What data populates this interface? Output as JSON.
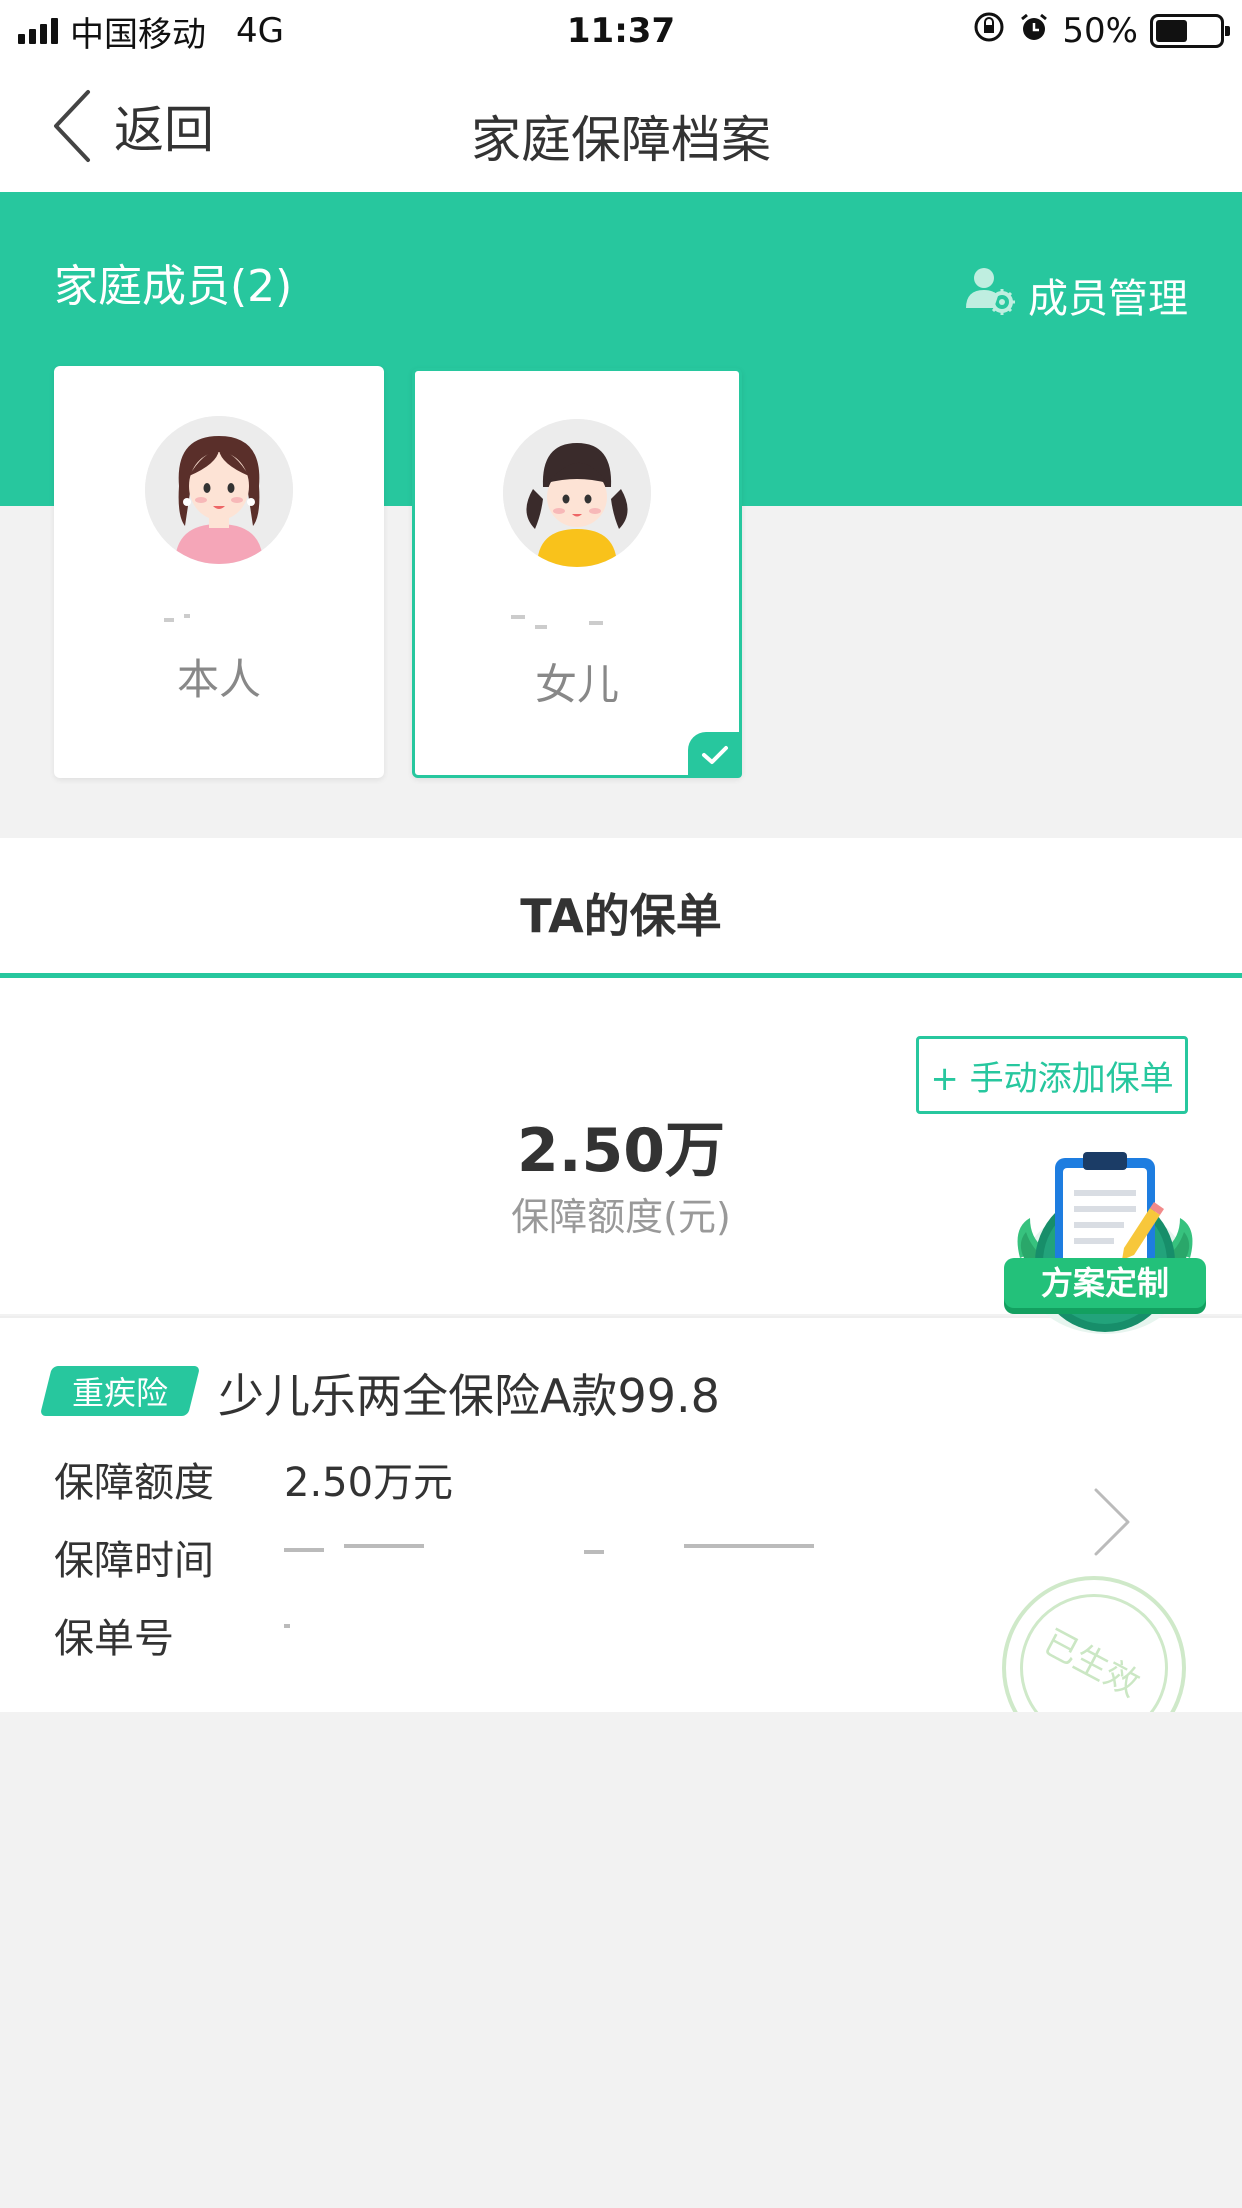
{
  "status_bar": {
    "carrier": "中国移动",
    "network": "4G",
    "time": "11:37",
    "battery": "50%",
    "battery_level": 0.5
  },
  "nav": {
    "back_label": "返回",
    "title": "家庭保障档案"
  },
  "family": {
    "title": "家庭成员(2)",
    "manage_label": "成员管理",
    "members": [
      {
        "relation": "本人",
        "selected": false
      },
      {
        "relation": "女儿",
        "selected": true
      }
    ]
  },
  "tab": {
    "title": "TA的保单"
  },
  "summary": {
    "add_button": "+ 手动添加保单",
    "amount": "2.50万",
    "amount_label": "保障额度(元)",
    "plan_badge": "方案定制"
  },
  "policy": {
    "tag": "重疾险",
    "name": "少儿乐两全保险A款99.8",
    "rows": [
      {
        "label": "保障额度",
        "value": "2.50万元"
      },
      {
        "label": "保障时间",
        "value": ""
      },
      {
        "label": "保单号",
        "value": ""
      }
    ],
    "status_stamp": "已生效"
  },
  "colors": {
    "accent": "#27c79e",
    "stamp": "#cfe9c9"
  }
}
